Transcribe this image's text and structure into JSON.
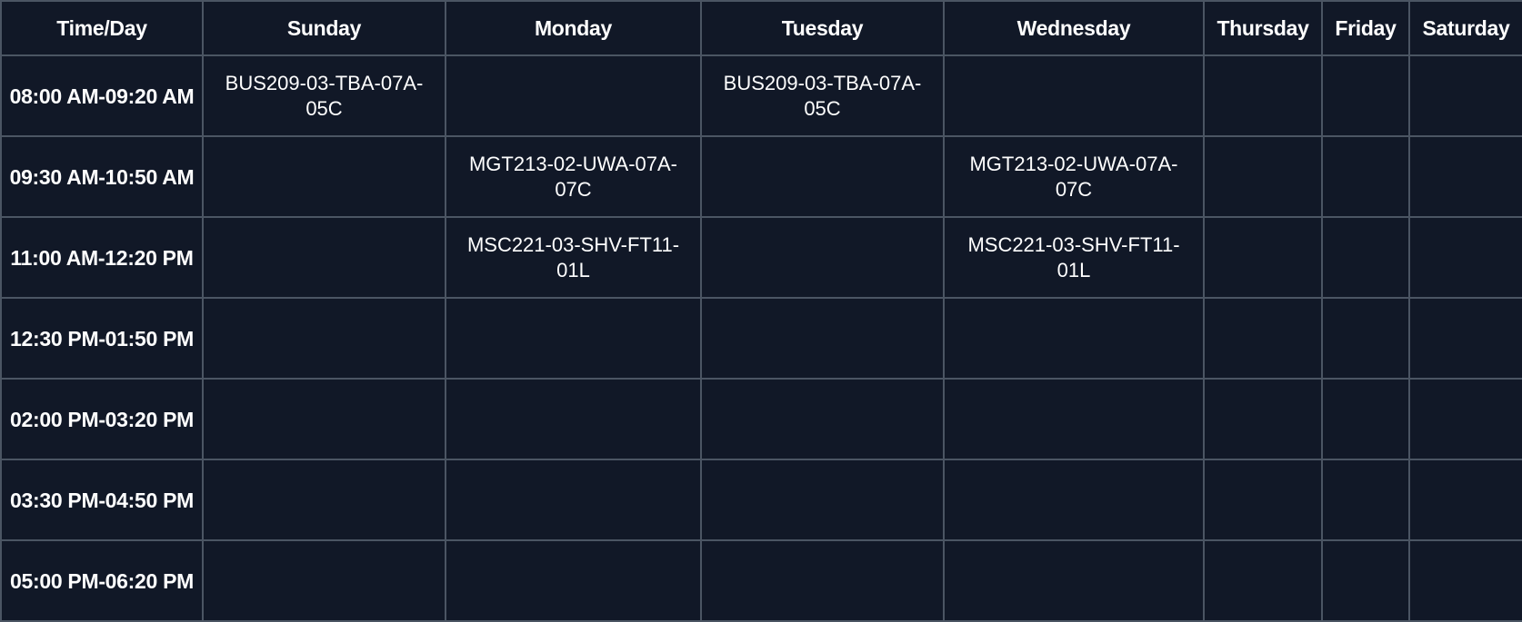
{
  "headers": [
    "Time/Day",
    "Sunday",
    "Monday",
    "Tuesday",
    "Wednesday",
    "Thursday",
    "Friday",
    "Saturday"
  ],
  "rows": [
    {
      "time": "08:00 AM-09:20 AM",
      "cells": [
        "BUS209-03-TBA-07A-05C",
        "",
        "BUS209-03-TBA-07A-05C",
        "",
        "",
        "",
        ""
      ]
    },
    {
      "time": "09:30 AM-10:50 AM",
      "cells": [
        "",
        "MGT213-02-UWA-07A-07C",
        "",
        "MGT213-02-UWA-07A-07C",
        "",
        "",
        ""
      ]
    },
    {
      "time": "11:00 AM-12:20 PM",
      "cells": [
        "",
        "MSC221-03-SHV-FT11-01L",
        "",
        "MSC221-03-SHV-FT11-01L",
        "",
        "",
        ""
      ]
    },
    {
      "time": "12:30 PM-01:50 PM",
      "cells": [
        "",
        "",
        "",
        "",
        "",
        "",
        ""
      ]
    },
    {
      "time": "02:00 PM-03:20 PM",
      "cells": [
        "",
        "",
        "",
        "",
        "",
        "",
        ""
      ]
    },
    {
      "time": "03:30 PM-04:50 PM",
      "cells": [
        "",
        "",
        "",
        "",
        "",
        "",
        ""
      ]
    },
    {
      "time": "05:00 PM-06:20 PM",
      "cells": [
        "",
        "",
        "",
        "",
        "",
        "",
        ""
      ]
    }
  ],
  "colors": {
    "background": "#111827",
    "border": "#4b5563",
    "text": "#ffffff"
  }
}
